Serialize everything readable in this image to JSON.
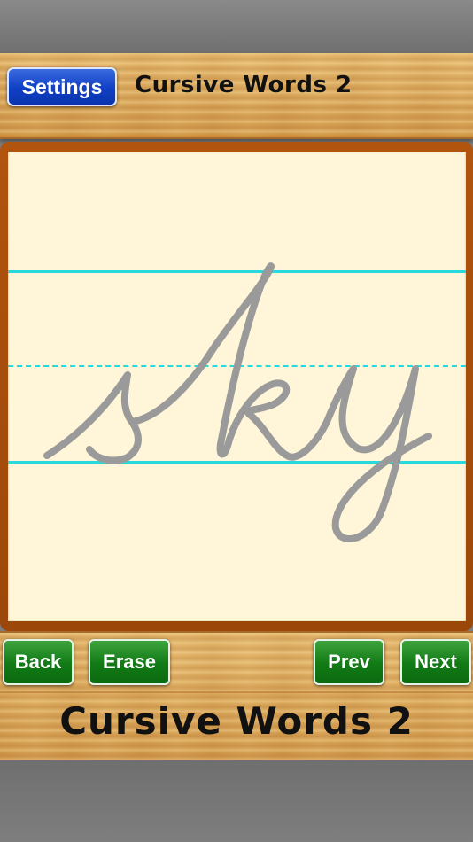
{
  "header": {
    "settings_label": "Settings",
    "title": "Cursive Words 2"
  },
  "practice": {
    "word": "sky",
    "colors": {
      "board_border": "#a84f0c",
      "paper": "#fff6d9",
      "guide_lines": "#27d8dd",
      "letter_stroke": "#9a9a9a"
    }
  },
  "controls": {
    "back_label": "Back",
    "erase_label": "Erase",
    "prev_label": "Prev",
    "next_label": "Next",
    "button_color": "#117a15"
  },
  "footer": {
    "title": "Cursive Words 2"
  }
}
